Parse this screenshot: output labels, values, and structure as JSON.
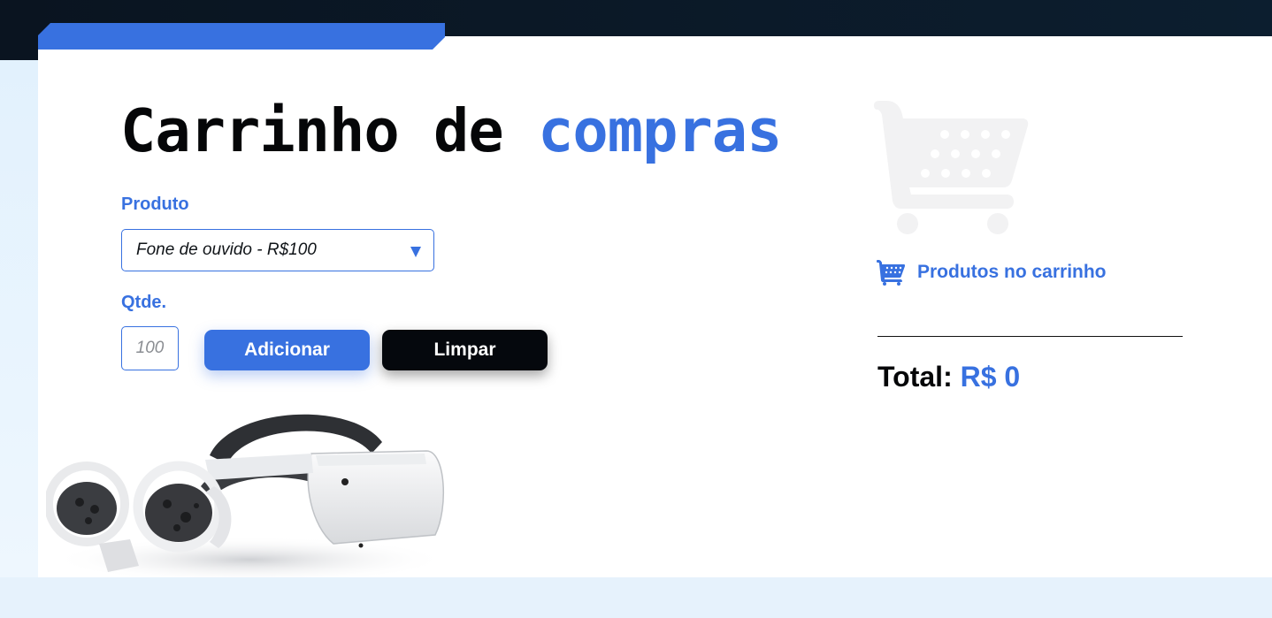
{
  "header": {
    "title_main": "Carrinho de ",
    "title_accent": "compras"
  },
  "form": {
    "product_label": "Produto",
    "product_selected": "Fone de ouvido - R$100",
    "qty_label": "Qtde.",
    "qty_placeholder": "100",
    "add_button": "Adicionar",
    "clear_button": "Limpar"
  },
  "cart": {
    "heading": "Produtos no carrinho",
    "total_label": "Total: ",
    "total_value": "R$ 0"
  },
  "icons": {
    "hero": "shopping-cart-icon",
    "cart_heading": "shopping-cart-icon"
  },
  "colors": {
    "accent": "#3871e0",
    "dark": "#05080d",
    "header_bg": "#0a1420"
  }
}
